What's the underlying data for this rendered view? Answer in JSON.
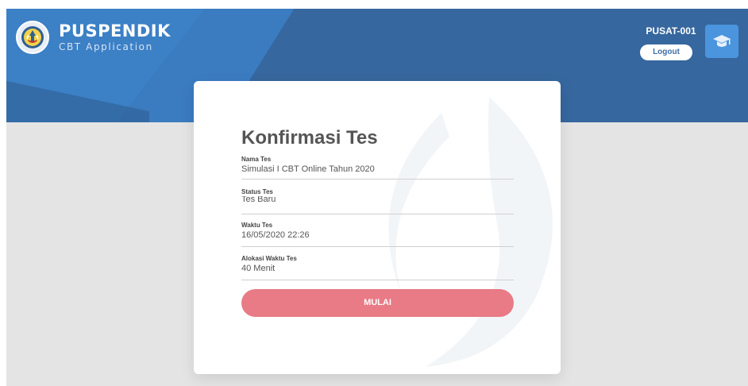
{
  "header": {
    "brand_name": "PUSPENDIK",
    "brand_subtitle": "CBT Application",
    "user_code": "PUSAT-001",
    "logout_label": "Logout"
  },
  "confirmation": {
    "title": "Konfirmasi Tes",
    "fields": [
      {
        "label": "Nama Tes",
        "value": "Simulasi I CBT Online Tahun 2020"
      },
      {
        "label": "Status Tes",
        "value": "Tes Baru"
      },
      {
        "label": "Waktu Tes",
        "value": "16/05/2020 22:26"
      },
      {
        "label": "Alokasi Waktu Tes",
        "value": "40 Menit"
      }
    ],
    "start_button_label": "MULAI"
  },
  "icons": {
    "logo": "tut-wuri-handayani-logo",
    "avatar": "graduation-cap-icon"
  },
  "colors": {
    "header_bg": "#36679e",
    "header_accent": "#4590d6",
    "content_bg": "#e4e4e4",
    "start_button": "#e87b86",
    "avatar_bg": "#4a95dd"
  }
}
